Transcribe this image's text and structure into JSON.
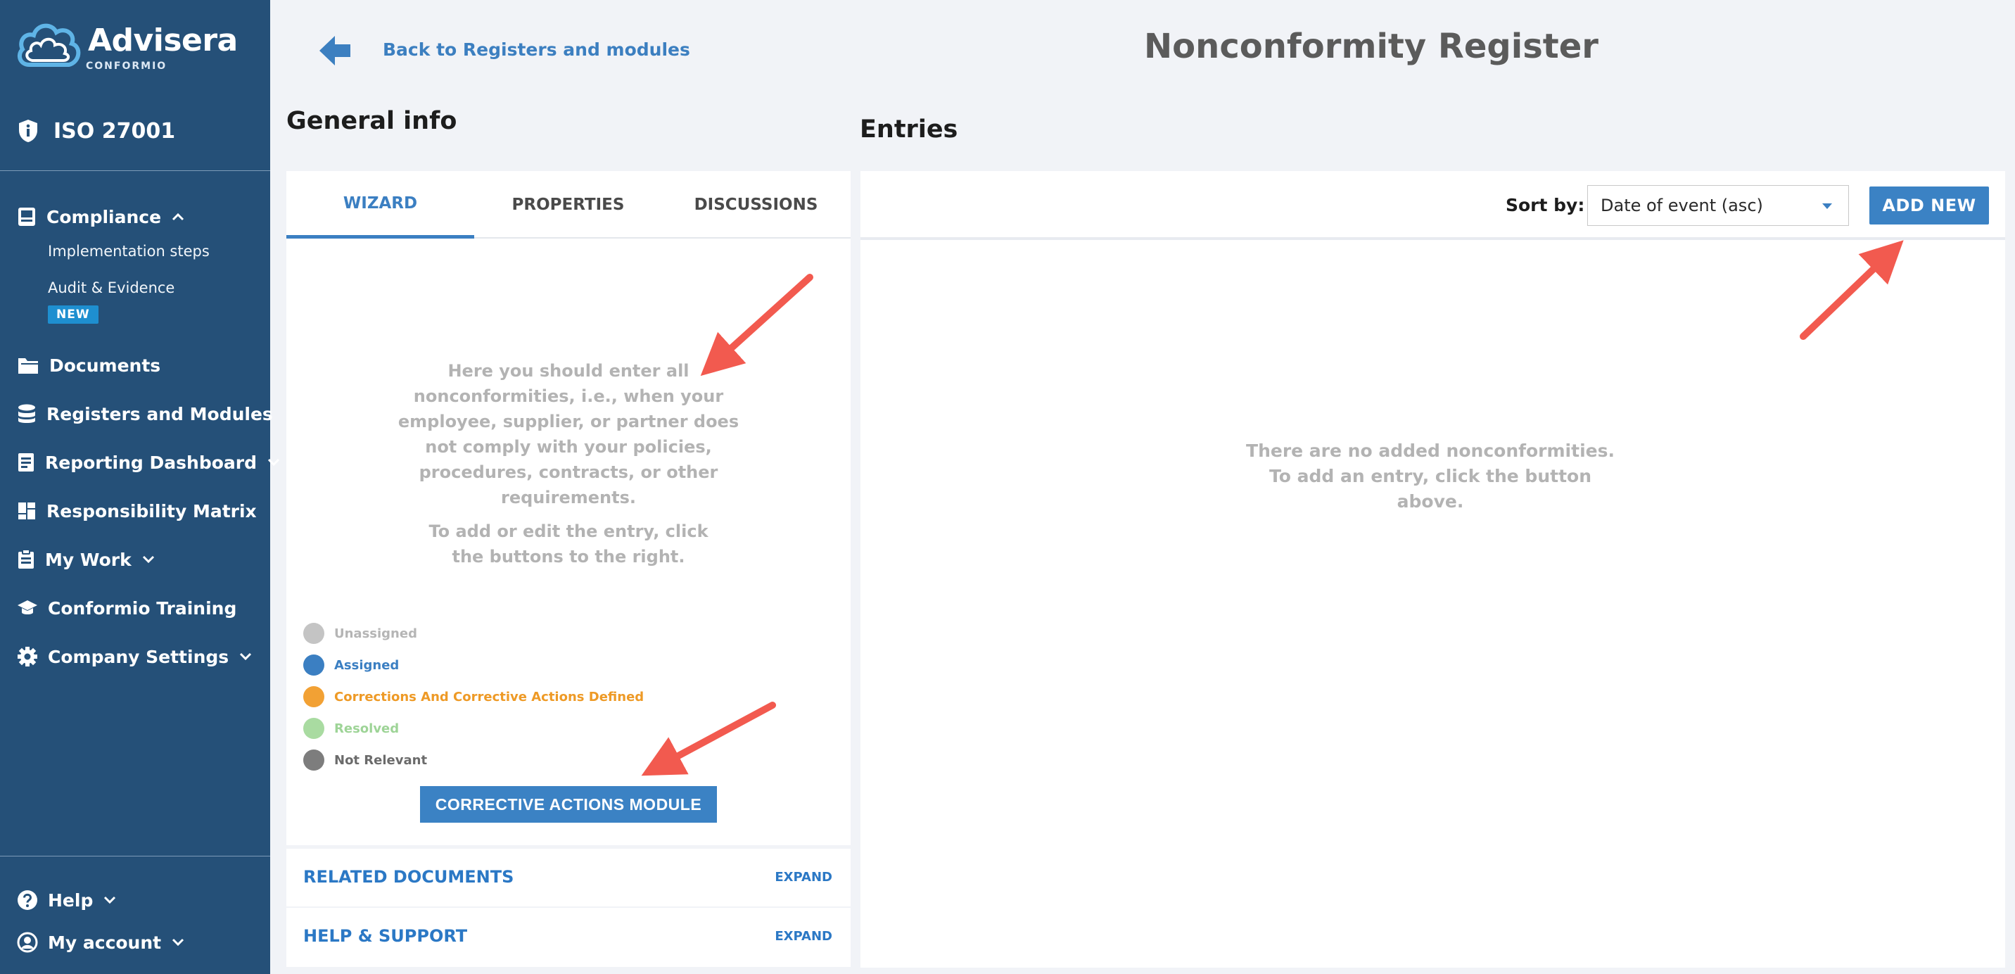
{
  "sidebar": {
    "logo_text": "Advisera",
    "logo_sub": "CONFORMIO",
    "standard": "ISO 27001",
    "compliance": {
      "label": "Compliance",
      "sub_items": [
        "Implementation steps",
        "Audit & Evidence"
      ],
      "badge": "NEW"
    },
    "items": [
      {
        "label": "Documents",
        "icon": "folder-icon"
      },
      {
        "label": "Registers and Modules",
        "icon": "database-icon"
      },
      {
        "label": "Reporting Dashboard",
        "icon": "report-icon"
      },
      {
        "label": "Responsibility Matrix",
        "icon": "grid-icon"
      },
      {
        "label": "My Work",
        "icon": "clipboard-icon"
      },
      {
        "label": "Conformio Training",
        "icon": "graduation-cap-icon"
      },
      {
        "label": "Company Settings",
        "icon": "gear-icon"
      }
    ],
    "help": "Help",
    "account": "My account"
  },
  "header": {
    "back_link": "Back to Registers and modules",
    "title": "Nonconformity Register"
  },
  "general_info": {
    "title": "General info",
    "tabs": [
      "WIZARD",
      "PROPERTIES",
      "DISCUSSIONS"
    ],
    "active_tab": "WIZARD",
    "wizard_text_1": "Here you should enter all nonconformities, i.e., when your employee, supplier, or partner does not comply with your policies, procedures, contracts, or other requirements.",
    "wizard_text_2": "To add or edit the entry, click the buttons to the right.",
    "legend": [
      {
        "label": "Unassigned",
        "color": "#c4c4c4",
        "text_color": "#b5b5b5"
      },
      {
        "label": "Assigned",
        "color": "#3b7fc2",
        "text_color": "#3b7fc2"
      },
      {
        "label": "Corrections And Corrective Actions Defined",
        "color": "#f2a134",
        "text_color": "#ee9a26"
      },
      {
        "label": "Resolved",
        "color": "#a9dba1",
        "text_color": "#9ed497"
      },
      {
        "label": "Not Relevant",
        "color": "#7d7d7d",
        "text_color": "#6b6b6b"
      }
    ],
    "corrective_button": "CORRECTIVE ACTIONS MODULE",
    "accordion": [
      {
        "title": "RELATED DOCUMENTS",
        "action": "EXPAND"
      },
      {
        "title": "HELP & SUPPORT",
        "action": "EXPAND"
      }
    ]
  },
  "entries": {
    "title": "Entries",
    "sort_label": "Sort by:",
    "sort_value": "Date of event (asc)",
    "add_button": "ADD NEW",
    "empty_text": "There are no added nonconformities. To add an entry, click the button above."
  },
  "colors": {
    "sidebar_bg": "#255078",
    "accent": "#3b82c4",
    "annotation": "#f25a4f"
  }
}
